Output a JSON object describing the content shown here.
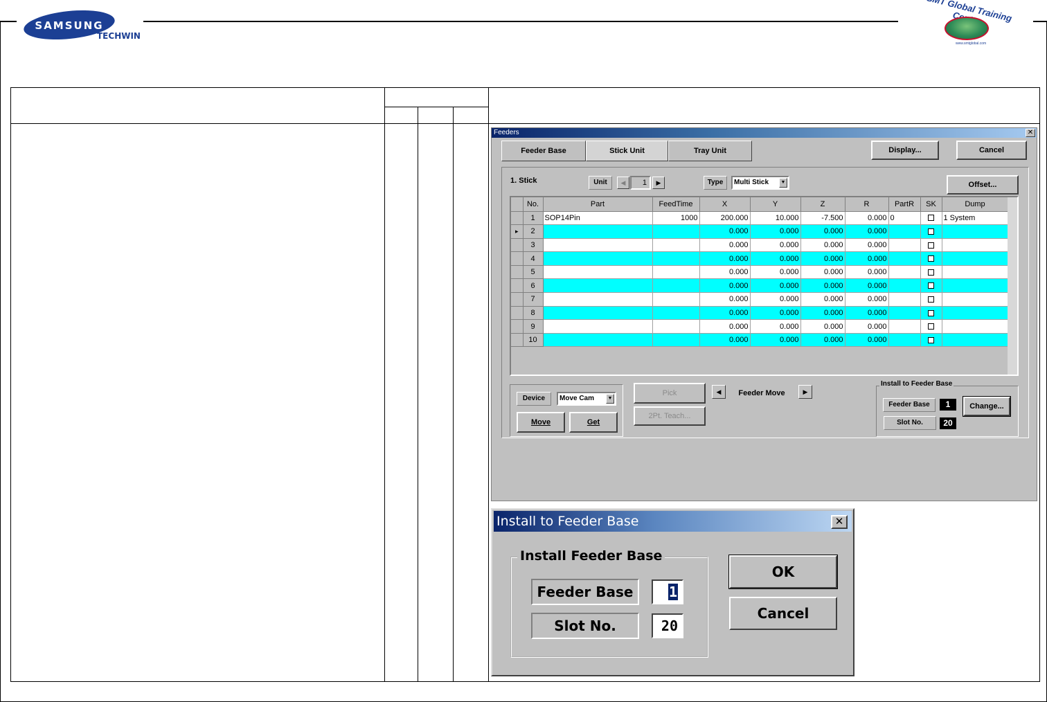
{
  "header": {
    "brand": "SAMSUNG",
    "brand_sub": "TECHWIN",
    "training_logo_text": "SMT Global Training Center",
    "training_logo_sub": "www.smtglobal.com"
  },
  "feeders_window": {
    "title": "Feeders",
    "close_glyph": "✕",
    "tabs": [
      "Feeder Base",
      "Stick Unit",
      "Tray Unit"
    ],
    "display_button": "Display...",
    "cancel_button": "Cancel",
    "section_label": "1. Stick",
    "unit_label": "Unit",
    "unit_value": "1",
    "type_label": "Type",
    "type_value": "Multi Stick",
    "offset_button": "Offset...",
    "grid": {
      "columns": [
        "No.",
        "Part",
        "FeedTime",
        "X",
        "Y",
        "Z",
        "R",
        "PartR",
        "SK",
        "Dump"
      ],
      "rows": [
        {
          "no": "1",
          "part": "SOP14Pin",
          "feedtime": "1000",
          "x": "200.000",
          "y": "10.000",
          "z": "-7.500",
          "r": "0.000",
          "partr": "0",
          "dump": "1 System",
          "color": "white",
          "current": false
        },
        {
          "no": "2",
          "part": "",
          "feedtime": "",
          "x": "0.000",
          "y": "0.000",
          "z": "0.000",
          "r": "0.000",
          "partr": "",
          "dump": "",
          "color": "cyan",
          "current": true
        },
        {
          "no": "3",
          "part": "",
          "feedtime": "",
          "x": "0.000",
          "y": "0.000",
          "z": "0.000",
          "r": "0.000",
          "partr": "",
          "dump": "",
          "color": "white",
          "current": false
        },
        {
          "no": "4",
          "part": "",
          "feedtime": "",
          "x": "0.000",
          "y": "0.000",
          "z": "0.000",
          "r": "0.000",
          "partr": "",
          "dump": "",
          "color": "cyan",
          "current": false
        },
        {
          "no": "5",
          "part": "",
          "feedtime": "",
          "x": "0.000",
          "y": "0.000",
          "z": "0.000",
          "r": "0.000",
          "partr": "",
          "dump": "",
          "color": "white",
          "current": false
        },
        {
          "no": "6",
          "part": "",
          "feedtime": "",
          "x": "0.000",
          "y": "0.000",
          "z": "0.000",
          "r": "0.000",
          "partr": "",
          "dump": "",
          "color": "cyan",
          "current": false
        },
        {
          "no": "7",
          "part": "",
          "feedtime": "",
          "x": "0.000",
          "y": "0.000",
          "z": "0.000",
          "r": "0.000",
          "partr": "",
          "dump": "",
          "color": "white",
          "current": false
        },
        {
          "no": "8",
          "part": "",
          "feedtime": "",
          "x": "0.000",
          "y": "0.000",
          "z": "0.000",
          "r": "0.000",
          "partr": "",
          "dump": "",
          "color": "cyan",
          "current": false
        },
        {
          "no": "9",
          "part": "",
          "feedtime": "",
          "x": "0.000",
          "y": "0.000",
          "z": "0.000",
          "r": "0.000",
          "partr": "",
          "dump": "",
          "color": "white",
          "current": false
        },
        {
          "no": "10",
          "part": "",
          "feedtime": "",
          "x": "0.000",
          "y": "0.000",
          "z": "0.000",
          "r": "0.000",
          "partr": "",
          "dump": "",
          "color": "cyan",
          "current": false
        }
      ]
    },
    "device_label": "Device",
    "device_value": "Move Cam",
    "move_button": "Move",
    "get_button": "Get",
    "pick_button": "Pick",
    "teach_button": "2Pt. Teach...",
    "feeder_move_label": "Feeder Move",
    "install_group_title": "Install to Feeder Base",
    "feeder_base_label": "Feeder Base",
    "feeder_base_value": "1",
    "slot_label": "Slot No.",
    "slot_value": "20",
    "change_button": "Change..."
  },
  "install_dialog": {
    "title": "Install to Feeder Base",
    "close_glyph": "✕",
    "group_title": "Install Feeder Base",
    "feeder_base_label": "Feeder Base",
    "feeder_base_value": "1",
    "slot_label": "Slot No.",
    "slot_value": "20",
    "ok_button": "OK",
    "cancel_button": "Cancel"
  },
  "colors": {
    "window_gray": "#c0c0c0",
    "grid_cyan": "#00ffff",
    "brand_blue": "#1c3f94",
    "titlebar_blue": "#0a246a"
  }
}
